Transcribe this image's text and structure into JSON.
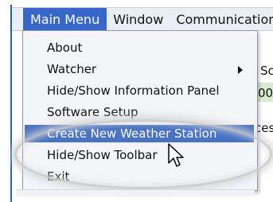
{
  "menubar": {
    "menus": [
      "Main Menu",
      "Window",
      "Communications"
    ]
  },
  "dropdown": {
    "items": [
      {
        "label": "About"
      },
      {
        "label": "Watcher"
      },
      {
        "label": "Hide/Show Information Panel"
      },
      {
        "label": "Software Setup"
      },
      {
        "label": "Create New Weather Station"
      },
      {
        "label": "Hide/Show Toolbar"
      },
      {
        "label": "Exit"
      }
    ],
    "highlighted_index": 4
  },
  "background": {
    "fragment_1": "Sc",
    "fragment_2": "00",
    "fragment_3": "ces"
  },
  "colors": {
    "menu_active_bg": "#3768c9",
    "highlight_bg": "#4a72c3",
    "menu_bg": "#f3f5f9"
  }
}
